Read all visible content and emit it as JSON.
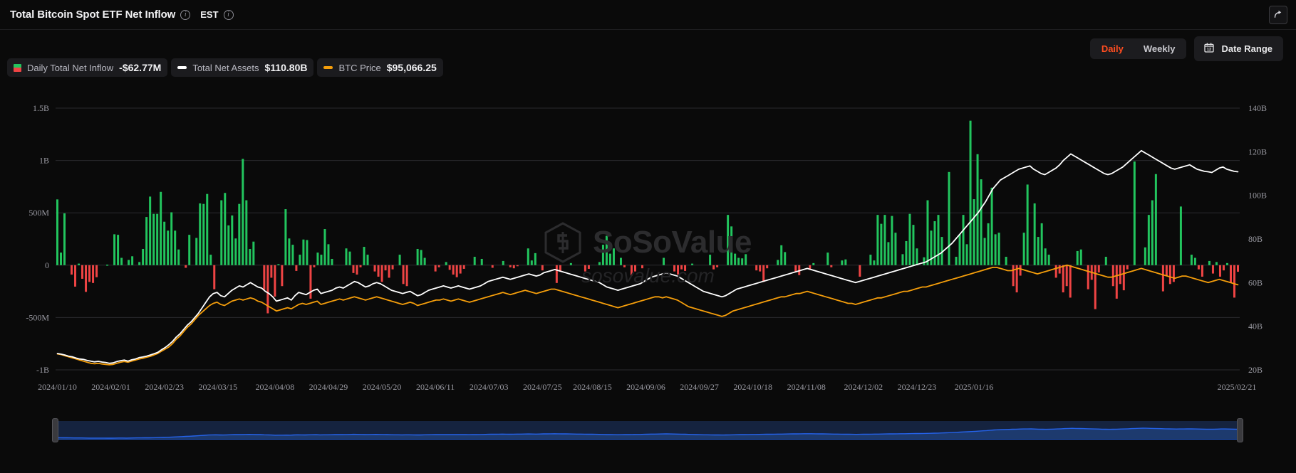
{
  "header": {
    "title": "Total Bitcoin Spot ETF Net Inflow",
    "info_icon": "info-icon",
    "timezone": "EST",
    "share_icon": "share-icon"
  },
  "controls": {
    "frequency_options": [
      "Daily",
      "Weekly"
    ],
    "frequency_selected": "Daily",
    "daily_label": "Daily",
    "weekly_label": "Weekly",
    "date_range_label": "Date Range",
    "calendar_icon": "calendar-icon",
    "accent_color": "#ff4d20"
  },
  "legend": [
    {
      "label": "Daily Total Net Inflow",
      "value": "-$62.77M",
      "swatch": "split-green-red",
      "color_up": "#22c55e",
      "color_down": "#ef4444"
    },
    {
      "label": "Total Net Assets",
      "value": "$110.80B",
      "swatch": "line",
      "color": "#ffffff"
    },
    {
      "label": "BTC Price",
      "value": "$95,066.25",
      "swatch": "line",
      "color": "#f59e0b"
    }
  ],
  "watermark": {
    "brand": "SoSoValue",
    "domain": "sosovalue.com",
    "logo_icon": "sosovalue-logo-icon"
  },
  "chart_data": {
    "type": "bar",
    "title": "Total Bitcoin Spot ETF Net Inflow",
    "xlabel": "",
    "ylabel": "Daily Total Net Inflow",
    "y2label": "Total Net Assets / BTC Price",
    "grid": true,
    "legend_position": "top-left",
    "ylim": [
      -1000000000,
      1500000000
    ],
    "ylim2": [
      20000000000,
      140000000000
    ],
    "ytick_labels": [
      "1.5B",
      "1B",
      "500M",
      "0",
      "-500M",
      "-1B"
    ],
    "ytick_values": [
      1500000000,
      1000000000,
      500000000,
      0,
      -500000000,
      -1000000000
    ],
    "y2tick_labels": [
      "140B",
      "120B",
      "100B",
      "80B",
      "60B",
      "40B",
      "20B"
    ],
    "y2tick_values": [
      140000000000,
      120000000000,
      100000000000,
      80000000000,
      60000000000,
      40000000000,
      20000000000
    ],
    "xtick_labels": [
      "2024/01/10",
      "2024/02/01",
      "2024/02/23",
      "2024/03/15",
      "2024/04/08",
      "2024/04/29",
      "2024/05/20",
      "2024/06/11",
      "2024/07/03",
      "2024/07/25",
      "2024/08/15",
      "2024/09/06",
      "2024/09/27",
      "2024/10/18",
      "2024/11/08",
      "2024/12/02",
      "2024/12/23",
      "2025/01/16",
      "2025/02/21"
    ],
    "xtick_positions": [
      0,
      15,
      30,
      45,
      61,
      76,
      91,
      106,
      121,
      136,
      150,
      165,
      180,
      195,
      210,
      226,
      241,
      257,
      282
    ],
    "series": [
      {
        "name": "Daily Total Net Inflow",
        "type": "bar",
        "axis": "left",
        "color_positive": "#22c55e",
        "color_negative": "#ef4444",
        "values": [
          628,
          120,
          495,
          0,
          -90,
          -205,
          15,
          -130,
          -255,
          -160,
          -170,
          -115,
          0,
          0,
          5,
          0,
          295,
          290,
          70,
          0,
          50,
          85,
          0,
          30,
          155,
          460,
          655,
          490,
          490,
          700,
          415,
          330,
          505,
          330,
          150,
          0,
          -25,
          290,
          0,
          260,
          590,
          585,
          680,
          100,
          -230,
          0,
          620,
          690,
          380,
          475,
          255,
          585,
          1015,
          620,
          155,
          225,
          0,
          0,
          -235,
          -460,
          -120,
          -300,
          10,
          -200,
          535,
          255,
          195,
          -55,
          100,
          245,
          240,
          -320,
          -20,
          120,
          100,
          345,
          200,
          60,
          0,
          0,
          0,
          160,
          130,
          -75,
          -90,
          -20,
          175,
          100,
          0,
          -60,
          -110,
          -160,
          -50,
          -120,
          -40,
          0,
          100,
          -180,
          -200,
          0,
          0,
          155,
          145,
          70,
          0,
          0,
          -60,
          -20,
          0,
          30,
          -45,
          -90,
          -115,
          -80,
          -35,
          0,
          0,
          80,
          0,
          60,
          0,
          0,
          -25,
          0,
          0,
          40,
          0,
          -20,
          -30,
          -10,
          0,
          0,
          160,
          45,
          115,
          0,
          -50,
          0,
          0,
          0,
          -170,
          -60,
          0,
          0,
          20,
          0,
          0,
          0,
          -60,
          -35,
          0,
          0,
          30,
          195,
          280,
          110,
          160,
          0,
          70,
          -20,
          0,
          -100,
          -60,
          0,
          -30,
          0,
          0,
          0,
          0,
          0,
          70,
          0,
          0,
          -60,
          -90,
          -40,
          -55,
          0,
          15,
          0,
          0,
          0,
          0,
          100,
          -40,
          -20,
          0,
          0,
          480,
          370,
          110,
          70,
          65,
          105,
          0,
          0,
          -50,
          -60,
          -160,
          -30,
          0,
          0,
          50,
          190,
          125,
          0,
          0,
          -60,
          -95,
          0,
          0,
          -45,
          20,
          0,
          0,
          0,
          120,
          -20,
          0,
          0,
          45,
          55,
          0,
          0,
          0,
          -110,
          0,
          0,
          100,
          45,
          480,
          395,
          480,
          220,
          470,
          310,
          0,
          105,
          230,
          490,
          385,
          160,
          0,
          75,
          620,
          330,
          420,
          480,
          270,
          0,
          890,
          0,
          80,
          295,
          480,
          200,
          1380,
          630,
          1060,
          820,
          260,
          400,
          740,
          295,
          310,
          0,
          80,
          0,
          -200,
          -260,
          -100,
          310,
          770,
          0,
          590,
          270,
          400,
          160,
          100,
          0,
          -120,
          -80,
          -260,
          -200,
          -310,
          0,
          135,
          150,
          0,
          -230,
          -140,
          -420,
          -70,
          0,
          80,
          0,
          -200,
          -320,
          -180,
          -240,
          -40,
          0,
          990,
          0,
          0,
          170,
          480,
          620,
          870,
          0,
          -250,
          -100,
          -180,
          -160,
          0,
          560,
          0,
          0,
          100,
          70,
          -40,
          -110,
          0,
          40,
          -80,
          30,
          -110,
          -50,
          20,
          -170,
          -310,
          -63
        ]
      },
      {
        "name": "Total Net Assets",
        "type": "line",
        "axis": "right",
        "color": "#ffffff",
        "values": [
          27.5,
          27.2,
          26.8,
          26.3,
          26.0,
          25.4,
          25.0,
          24.8,
          24.3,
          24.0,
          23.7,
          23.9,
          23.6,
          23.4,
          23.0,
          23.2,
          23.8,
          24.2,
          24.5,
          24.0,
          24.6,
          25.0,
          25.6,
          25.9,
          26.3,
          26.8,
          27.4,
          28.0,
          29.2,
          30.2,
          31.5,
          33.0,
          35.0,
          36.5,
          38.5,
          40.5,
          42.0,
          44.0,
          46.0,
          48.5,
          51.0,
          53.5,
          55.0,
          55.5,
          54.0,
          53.5,
          55.0,
          56.5,
          57.5,
          58.5,
          58.0,
          59.0,
          60.0,
          59.0,
          58.0,
          57.5,
          56.0,
          55.0,
          53.5,
          51.5,
          52.0,
          52.5,
          53.0,
          52.0,
          54.0,
          55.5,
          55.0,
          54.5,
          55.5,
          56.5,
          57.0,
          55.0,
          55.5,
          56.0,
          56.5,
          57.5,
          58.0,
          57.5,
          58.5,
          59.5,
          60.5,
          60.0,
          59.0,
          58.0,
          58.5,
          59.5,
          60.0,
          59.5,
          58.5,
          57.5,
          56.5,
          56.0,
          55.5,
          55.0,
          55.5,
          56.0,
          55.0,
          54.0,
          54.5,
          55.5,
          56.5,
          57.0,
          57.5,
          58.0,
          58.5,
          58.0,
          57.5,
          58.0,
          58.5,
          58.0,
          57.5,
          57.0,
          57.5,
          58.0,
          58.5,
          59.5,
          60.5,
          61.0,
          61.5,
          62.0,
          62.5,
          62.0,
          61.5,
          62.0,
          62.5,
          63.0,
          63.5,
          64.0,
          63.5,
          63.0,
          63.5,
          64.5,
          65.0,
          65.5,
          66.0,
          65.5,
          65.0,
          64.5,
          64.0,
          63.5,
          63.0,
          62.5,
          62.0,
          61.5,
          61.0,
          60.5,
          60.0,
          59.0,
          58.0,
          57.5,
          57.0,
          56.5,
          57.0,
          57.5,
          58.0,
          58.5,
          59.0,
          59.5,
          60.5,
          61.5,
          62.5,
          63.0,
          63.5,
          64.0,
          64.5,
          64.0,
          63.5,
          63.0,
          62.0,
          61.0,
          60.0,
          59.0,
          58.0,
          57.0,
          56.0,
          55.5,
          55.0,
          54.5,
          54.0,
          53.5,
          54.0,
          55.0,
          56.0,
          57.0,
          57.5,
          58.0,
          58.5,
          59.0,
          59.5,
          60.0,
          60.5,
          61.0,
          61.5,
          62.0,
          62.5,
          63.0,
          63.5,
          64.0,
          64.5,
          65.0,
          65.5,
          66.0,
          66.5,
          66.0,
          65.5,
          65.0,
          64.5,
          64.0,
          63.5,
          63.0,
          62.5,
          62.0,
          61.5,
          61.0,
          60.5,
          60.0,
          60.5,
          61.0,
          61.5,
          62.0,
          62.5,
          63.0,
          63.5,
          64.0,
          64.5,
          65.0,
          65.5,
          66.0,
          66.5,
          67.0,
          67.5,
          68.0,
          68.5,
          69.0,
          69.5,
          70.5,
          71.5,
          72.5,
          73.5,
          75.0,
          76.5,
          78.0,
          80.0,
          82.0,
          84.0,
          86.0,
          88.0,
          90.0,
          92.0,
          94.5,
          97.0,
          100.0,
          103.0,
          105.0,
          107.0,
          108.0,
          109.0,
          110.0,
          111.0,
          112.0,
          112.5,
          113.0,
          113.5,
          112.0,
          111.0,
          110.0,
          109.5,
          110.5,
          111.5,
          112.5,
          114.0,
          116.0,
          117.5,
          119.0,
          118.0,
          117.0,
          116.0,
          115.0,
          114.0,
          113.0,
          112.0,
          111.0,
          110.0,
          109.5,
          110.0,
          111.0,
          112.0,
          113.0,
          114.5,
          116.0,
          117.5,
          119.0,
          120.5,
          119.5,
          118.5,
          117.5,
          116.5,
          115.5,
          114.5,
          113.5,
          112.5,
          112.0,
          112.5,
          113.0,
          113.5,
          114.0,
          113.0,
          112.0,
          111.5,
          111.0,
          110.8,
          110.5,
          111.5,
          112.5,
          113.0,
          112.0,
          111.5,
          111.0,
          110.8
        ]
      },
      {
        "name": "BTC Price",
        "type": "line",
        "axis": "right",
        "color": "#f59e0b",
        "values": [
          27.3,
          27.0,
          26.5,
          26.0,
          25.5,
          25.0,
          24.5,
          24.0,
          23.5,
          23.0,
          22.8,
          23.0,
          22.7,
          22.5,
          22.3,
          22.5,
          23.0,
          23.5,
          23.8,
          23.5,
          24.0,
          24.5,
          25.0,
          25.3,
          25.8,
          26.2,
          26.8,
          27.5,
          28.5,
          29.5,
          30.5,
          32.0,
          34.0,
          35.5,
          37.5,
          39.5,
          41.0,
          43.0,
          45.0,
          46.5,
          48.0,
          49.5,
          50.5,
          51.0,
          50.0,
          49.5,
          50.5,
          51.5,
          52.0,
          52.5,
          52.0,
          52.5,
          53.0,
          52.5,
          51.5,
          51.0,
          50.0,
          49.0,
          48.0,
          47.0,
          47.5,
          48.0,
          48.5,
          48.0,
          49.0,
          50.0,
          50.5,
          50.0,
          50.5,
          51.0,
          51.5,
          50.0,
          50.5,
          51.0,
          51.5,
          52.0,
          52.5,
          52.0,
          52.5,
          53.0,
          53.5,
          53.0,
          52.5,
          52.0,
          52.5,
          53.0,
          53.5,
          53.0,
          52.5,
          52.0,
          51.5,
          51.0,
          50.5,
          50.0,
          50.5,
          51.0,
          50.5,
          49.5,
          50.0,
          50.5,
          51.0,
          51.5,
          52.0,
          52.0,
          52.5,
          52.0,
          51.5,
          52.0,
          52.5,
          52.0,
          51.5,
          51.0,
          51.5,
          52.0,
          52.5,
          53.0,
          53.5,
          54.0,
          54.5,
          55.0,
          55.5,
          55.0,
          54.5,
          55.0,
          55.5,
          56.0,
          56.5,
          56.0,
          55.5,
          55.0,
          55.5,
          56.0,
          56.5,
          57.0,
          57.0,
          56.5,
          56.0,
          55.5,
          55.0,
          54.5,
          54.0,
          53.5,
          53.0,
          52.5,
          52.0,
          51.5,
          51.0,
          50.5,
          50.0,
          49.5,
          49.0,
          48.5,
          49.0,
          49.5,
          50.0,
          50.5,
          51.0,
          51.5,
          52.0,
          52.5,
          53.0,
          53.5,
          53.5,
          53.0,
          53.5,
          53.0,
          52.5,
          52.0,
          51.0,
          50.0,
          49.0,
          48.5,
          48.0,
          47.5,
          47.0,
          46.5,
          46.0,
          45.5,
          45.0,
          44.5,
          45.0,
          46.0,
          47.0,
          47.5,
          48.0,
          48.5,
          49.0,
          49.5,
          50.0,
          50.5,
          51.0,
          51.5,
          52.0,
          52.5,
          53.0,
          53.5,
          53.5,
          54.0,
          54.5,
          55.0,
          55.0,
          55.5,
          56.0,
          55.5,
          55.0,
          54.5,
          54.0,
          53.5,
          53.0,
          52.5,
          52.0,
          51.5,
          51.0,
          50.5,
          50.5,
          50.0,
          50.5,
          51.0,
          51.5,
          52.0,
          52.5,
          53.0,
          53.0,
          53.5,
          54.0,
          54.5,
          55.0,
          55.5,
          56.0,
          56.0,
          56.5,
          57.0,
          57.5,
          58.0,
          58.0,
          58.5,
          59.0,
          59.5,
          60.0,
          60.5,
          61.0,
          61.5,
          62.0,
          62.5,
          63.0,
          63.5,
          64.0,
          64.5,
          65.0,
          65.5,
          66.0,
          66.5,
          67.0,
          67.0,
          66.5,
          66.0,
          65.5,
          65.5,
          66.0,
          66.5,
          66.0,
          65.5,
          65.0,
          64.5,
          64.0,
          64.5,
          65.0,
          65.5,
          66.0,
          66.5,
          67.0,
          67.5,
          68.0,
          67.5,
          67.0,
          66.5,
          66.0,
          65.5,
          65.0,
          64.5,
          64.0,
          63.5,
          63.0,
          62.5,
          62.5,
          63.0,
          63.5,
          64.0,
          64.5,
          65.0,
          65.5,
          66.0,
          66.5,
          66.0,
          65.5,
          65.0,
          64.5,
          64.0,
          63.5,
          63.0,
          62.5,
          62.0,
          62.5,
          63.0,
          63.0,
          62.5,
          62.0,
          61.5,
          61.0,
          60.5,
          60.0,
          60.5,
          61.0,
          61.5,
          61.0,
          60.5,
          60.0,
          59.5,
          59.0
        ]
      }
    ],
    "brush": {
      "color": "#2563eb",
      "fill": "#1d3a6e",
      "selection_start": 0,
      "selection_end": 100
    }
  }
}
